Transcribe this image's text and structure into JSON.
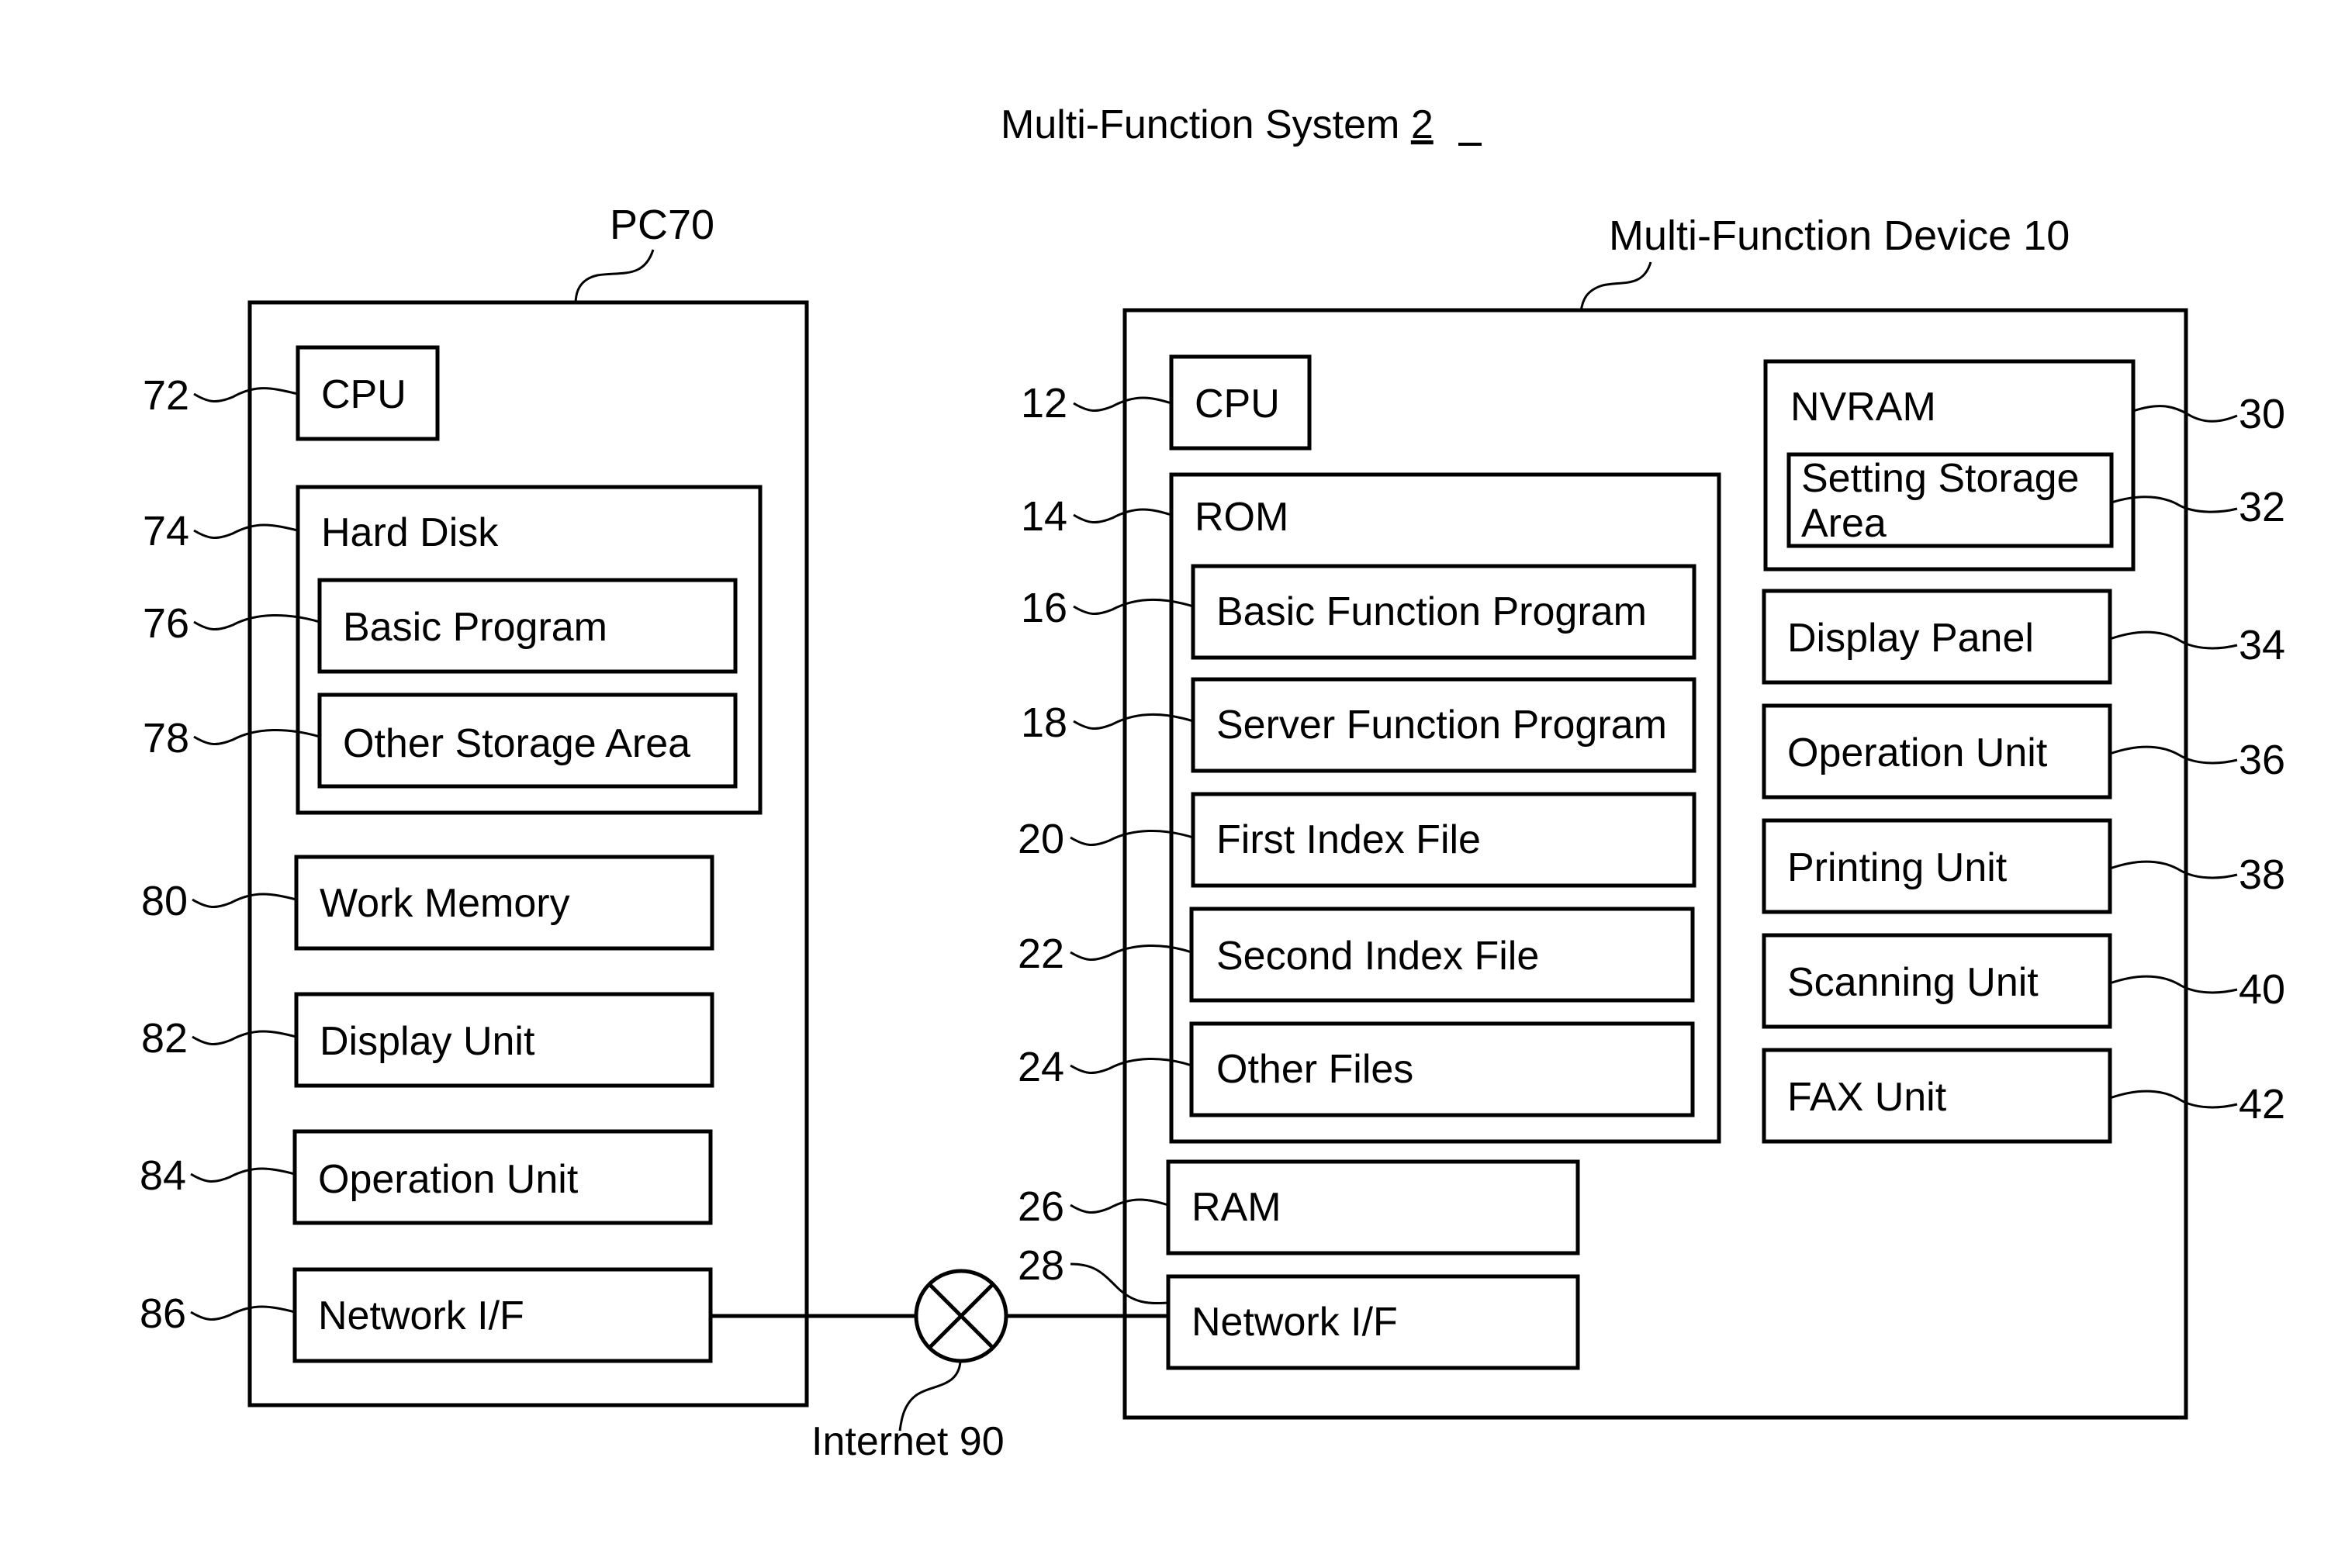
{
  "title": {
    "text": "Multi-Function System ",
    "number": "2"
  },
  "pc": {
    "label": "PC70",
    "components": {
      "cpu": {
        "label": "CPU",
        "ref": "72"
      },
      "hard_disk": {
        "label": "Hard Disk",
        "ref": "74"
      },
      "basic_program": {
        "label": "Basic Program",
        "ref": "76"
      },
      "other_storage": {
        "label": "Other Storage Area",
        "ref": "78"
      },
      "work_memory": {
        "label": "Work Memory",
        "ref": "80"
      },
      "display_unit": {
        "label": "Display Unit",
        "ref": "82"
      },
      "operation_unit": {
        "label": "Operation Unit",
        "ref": "84"
      },
      "network_if": {
        "label": "Network I/F",
        "ref": "86"
      }
    }
  },
  "mfd": {
    "label": "Multi-Function Device 10",
    "components": {
      "cpu": {
        "label": "CPU",
        "ref": "12"
      },
      "rom": {
        "label": "ROM",
        "ref": "14"
      },
      "basic_function_program": {
        "label": "Basic Function Program",
        "ref": "16"
      },
      "server_function_program": {
        "label": "Server Function Program",
        "ref": "18"
      },
      "first_index_file": {
        "label": "First Index File",
        "ref": "20"
      },
      "second_index_file": {
        "label": "Second Index File",
        "ref": "22"
      },
      "other_files": {
        "label": "Other Files",
        "ref": "24"
      },
      "ram": {
        "label": "RAM",
        "ref": "26"
      },
      "network_if": {
        "label": "Network I/F",
        "ref": "28"
      },
      "nvram": {
        "label": "NVRAM",
        "ref": "30"
      },
      "setting_storage": {
        "label_line1": "Setting Storage",
        "label_line2": "Area",
        "ref": "32"
      },
      "display_panel": {
        "label": "Display Panel",
        "ref": "34"
      },
      "operation_unit": {
        "label": "Operation Unit",
        "ref": "36"
      },
      "printing_unit": {
        "label": "Printing Unit",
        "ref": "38"
      },
      "scanning_unit": {
        "label": "Scanning Unit",
        "ref": "40"
      },
      "fax_unit": {
        "label": "FAX Unit",
        "ref": "42"
      }
    }
  },
  "network": {
    "label": "Internet 90",
    "icon": "network-cross-circle-icon"
  }
}
